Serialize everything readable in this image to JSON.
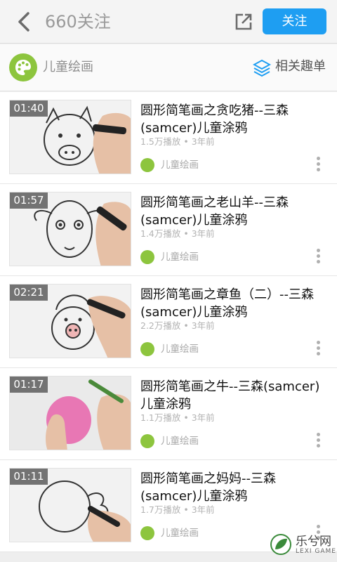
{
  "header": {
    "title": "660关注",
    "follow_label": "关注"
  },
  "channel": {
    "name": "儿童绘画",
    "related_label": "相关趣单"
  },
  "videos": [
    {
      "duration": "01:40",
      "title": "圆形简笔画之贪吃猪--三森(samcer)儿童涂鸦",
      "meta": "1.5万播放 • 3年前",
      "author": "儿童绘画"
    },
    {
      "duration": "01:57",
      "title": "圆形简笔画之老山羊--三森(samcer)儿童涂鸦",
      "meta": "1.4万播放 • 3年前",
      "author": "儿童绘画"
    },
    {
      "duration": "02:21",
      "title": "圆形简笔画之章鱼（二）--三森(samcer)儿童涂鸦",
      "meta": "2.2万播放 • 3年前",
      "author": "儿童绘画"
    },
    {
      "duration": "01:17",
      "title": "圆形简笔画之牛--三森(samcer)儿童涂鸦",
      "meta": "1.1万播放 • 3年前",
      "author": "儿童绘画"
    },
    {
      "duration": "01:11",
      "title": "圆形简笔画之妈妈--三森(samcer)儿童涂鸦",
      "meta": "1.7万播放 • 3年前",
      "author": "儿童绘画"
    }
  ],
  "watermark": {
    "text": "乐兮网",
    "subtext": "LEXI GAME"
  },
  "colors": {
    "accent": "#1e9ef2",
    "channel_green": "#8dc53e"
  },
  "icons": {
    "back": "chevron-left-icon",
    "share": "share-icon",
    "related": "layers-icon",
    "more": "more-vertical-icon",
    "palette": "palette-icon"
  }
}
